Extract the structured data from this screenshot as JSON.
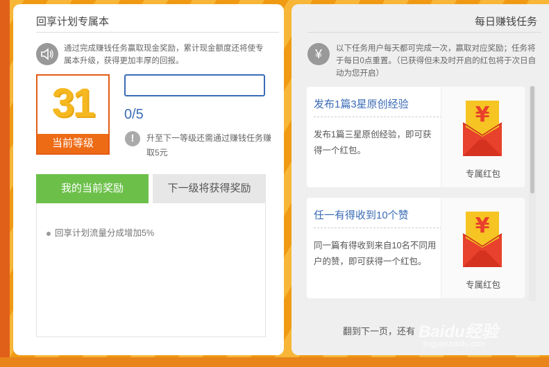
{
  "left": {
    "title": "回享计划专属本",
    "description": "通过完成赚钱任务赢取现金奖励，累计现金额度还将使专属本升级，获得更加丰厚的回报。",
    "level": {
      "number": "31",
      "label": "当前等级"
    },
    "progress": {
      "text": "0/5",
      "fraction": 0
    },
    "next_level_hint": "升至下一等级还需通过赚钱任务赚取5元",
    "tabs": [
      {
        "label": "我的当前奖励"
      },
      {
        "label": "下一级将获得奖励"
      }
    ],
    "current_rewards": [
      "回享计划流量分成增加5%"
    ]
  },
  "right": {
    "title": "每日赚钱任务",
    "description": "以下任务用户每天都可完成一次，赢取对应奖励；任务将于每日0点重置。（已获得但未及时开启的红包将于次日自动为您开启）",
    "tasks": [
      {
        "title": "发布1篇3星原创经验",
        "desc": "发布1篇三星原创经验，即可获得一个红包。",
        "reward": "专属红包"
      },
      {
        "title": "任一有得收到10个赞",
        "desc": "同一篇有得收到来自10名不同用户的赞，即可获得一个红包。",
        "reward": "专属红包"
      }
    ],
    "footer": "翻到下一页，还有"
  },
  "watermark": {
    "brand": "Baidu经验",
    "url": "jingyan.baidu.com"
  },
  "icons": {
    "speaker": "speaker-icon",
    "yuan": "yuan-icon",
    "info": "exclamation-icon",
    "red_envelope": "red-envelope-icon"
  },
  "colors": {
    "accent_orange": "#ee6b16",
    "level_yellow": "#f5b820",
    "link_blue": "#3a6bb5",
    "tab_green": "#6cc04a",
    "envelope_red": "#e8412c",
    "envelope_gold": "#f6c423"
  }
}
